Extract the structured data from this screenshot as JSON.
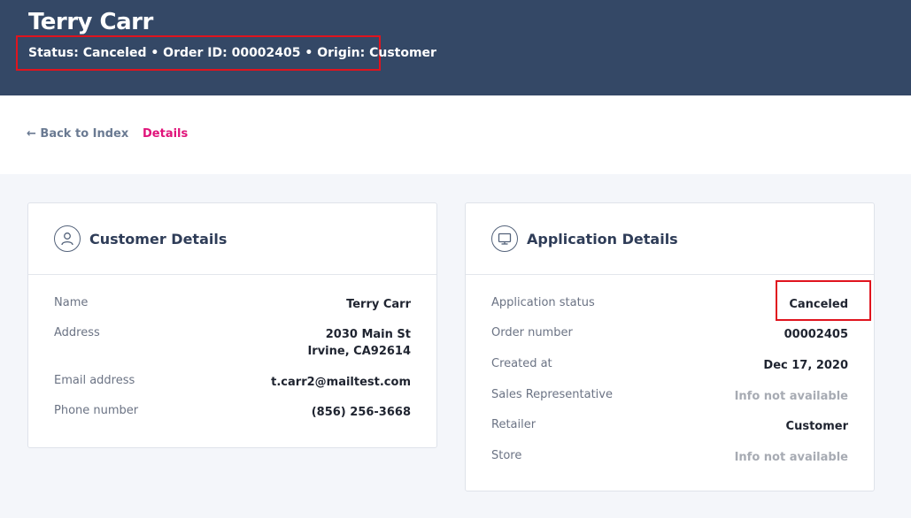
{
  "header": {
    "title": "Terry Carr",
    "meta": "Status: Canceled • Order ID: 00002405 • Origin: Customer"
  },
  "nav": {
    "back_label": "← Back to Index",
    "details_label": "Details"
  },
  "customer": {
    "title": "Customer Details",
    "icon": "user-icon",
    "rows": [
      {
        "label": "Name",
        "value": "Terry Carr"
      },
      {
        "label": "Address",
        "value_line1": "2030 Main St",
        "value_line2": "Irvine, CA92614"
      },
      {
        "label": "Email address",
        "value": "t.carr2@mailtest.com"
      },
      {
        "label": "Phone number",
        "value": "(856) 256-3668"
      }
    ]
  },
  "application": {
    "title": "Application Details",
    "icon": "monitor-icon",
    "rows": [
      {
        "label": "Application status",
        "value": "Canceled"
      },
      {
        "label": "Order number",
        "value": "00002405"
      },
      {
        "label": "Created at",
        "value": "Dec 17, 2020"
      },
      {
        "label": "Sales Representative",
        "value": "Info not available"
      },
      {
        "label": "Retailer",
        "value": "Customer"
      },
      {
        "label": "Store",
        "value": "Info not available"
      }
    ]
  },
  "colors": {
    "header_bg": "#344866",
    "accent": "#e0147a",
    "highlight": "#e0141e"
  }
}
